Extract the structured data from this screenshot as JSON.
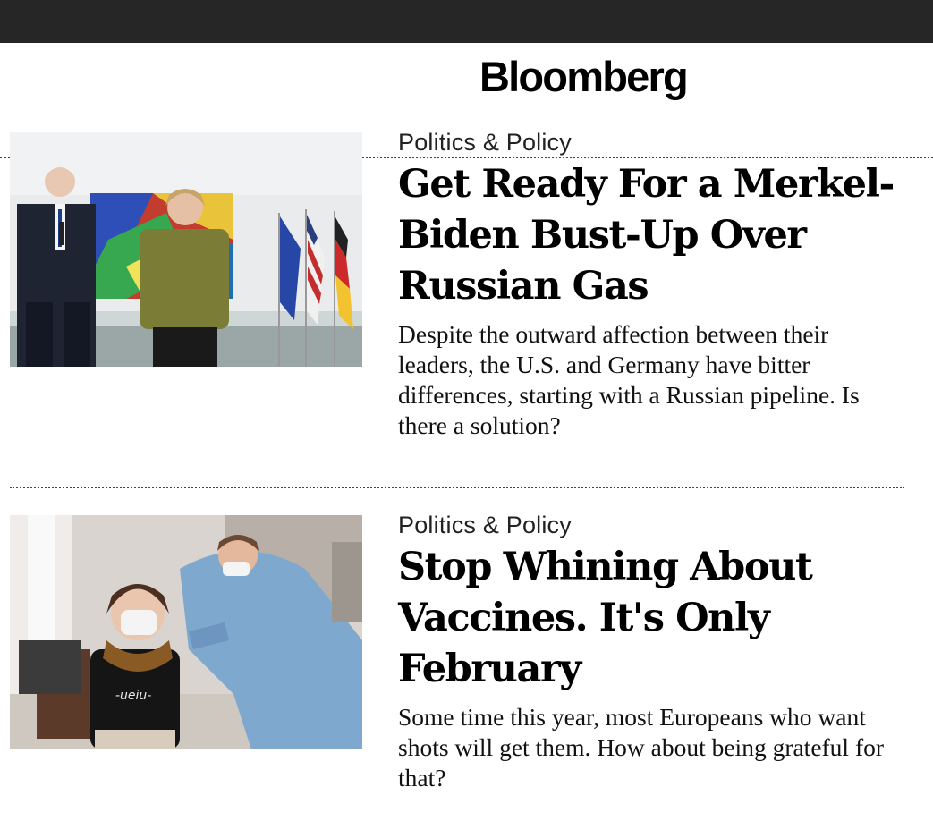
{
  "header": {
    "brand": "Bloomberg"
  },
  "stories": [
    {
      "kicker": "Politics & Policy",
      "headline": "Get Ready For a Merkel-Biden Bust-Up Over Russian Gas",
      "dek": "Despite the outward affection between their leaders, the U.S. and Germany have bitter differences, starting with a Russian pipeline. Is there a solution?"
    },
    {
      "kicker": "Politics & Policy",
      "headline": "Stop Whining About Vaccines. It's Only February",
      "dek": "Some time this year, most Europeans who want shots will get them. How about being grateful for that?",
      "photo_shirt_text": "-ueiu-"
    }
  ]
}
